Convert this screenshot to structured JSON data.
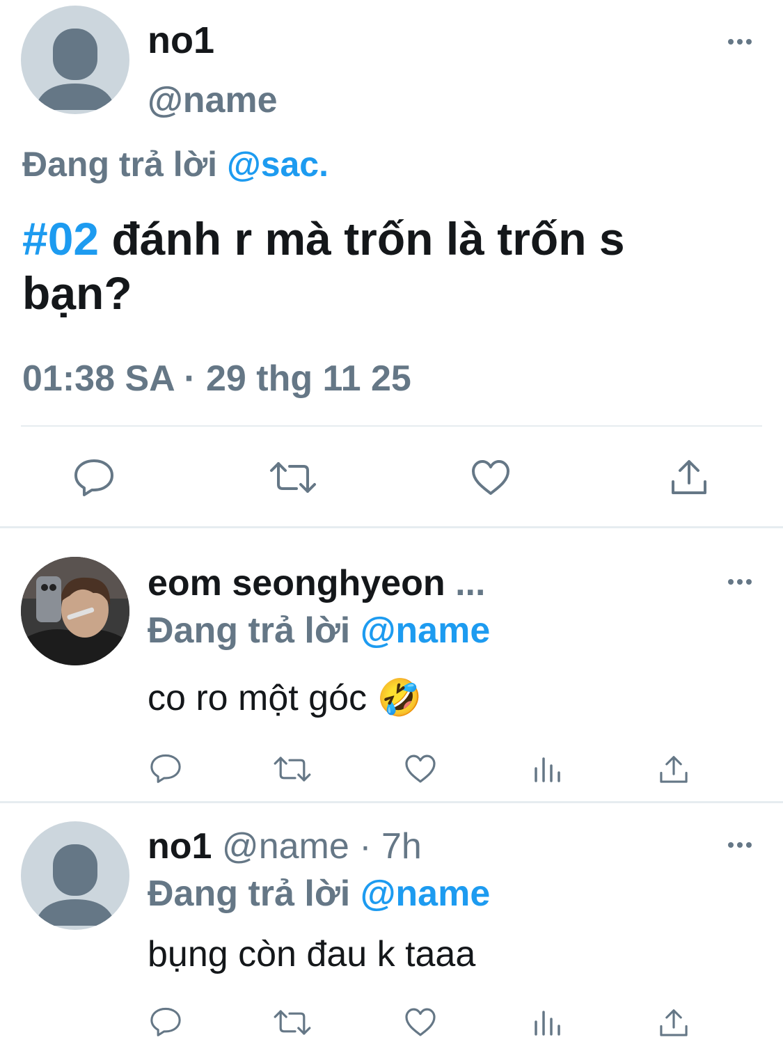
{
  "main_tweet": {
    "display_name": "no1",
    "handle": "@name",
    "reply_prefix": "Đang trả lời",
    "reply_to": "@sac.",
    "hashtag": "#02",
    "text_line1": "đánh r mà trốn là trốn s",
    "text_line2": "bạn?",
    "timestamp": "01:38 SA · 29 thg 11 25"
  },
  "replies": [
    {
      "display_name": "eom seonghyeon",
      "truncation": "...",
      "reply_prefix": "Đang trả lời",
      "reply_to": "@name",
      "text": "co ro một góc",
      "emoji": "🤣"
    },
    {
      "display_name": "no1",
      "handle_time": "@name · 7h",
      "reply_prefix": "Đang trả lời",
      "reply_to": "@name",
      "text": "bụng còn đau k taaa"
    }
  ],
  "icons": {
    "more": "more-dots-icon",
    "reply": "reply-bubble-icon",
    "retweet": "retweet-icon",
    "like": "heart-icon",
    "views": "views-bar-chart-icon",
    "share": "share-upload-icon"
  },
  "colors": {
    "accent": "#1d9bf0",
    "muted": "#657786",
    "text": "#14171a",
    "avatar_placeholder": "#ccd6dd"
  }
}
